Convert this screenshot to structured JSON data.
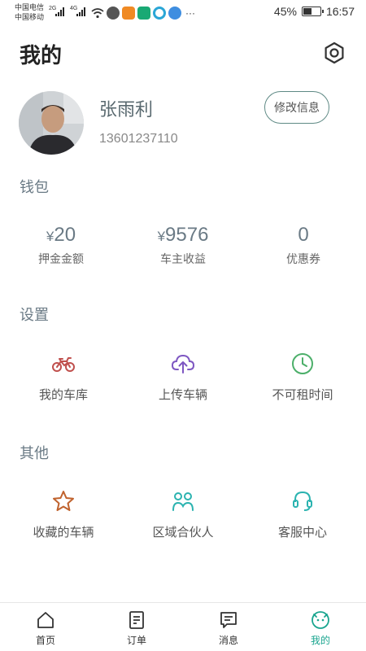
{
  "status_bar": {
    "carrier1": "中国电信",
    "carrier2": "中国移动",
    "net1": "2G",
    "net2": "4G",
    "more": "···",
    "battery": "45%",
    "time": "16:57"
  },
  "header": {
    "title": "我的",
    "settings_icon": "settings-hexagon-icon"
  },
  "profile": {
    "name": "张雨利",
    "phone": "13601237110",
    "edit_label": "修改信息"
  },
  "wallet": {
    "title": "钱包",
    "items": [
      {
        "currency": "¥",
        "value": "20",
        "label": "押金金额"
      },
      {
        "currency": "¥",
        "value": "9576",
        "label": "车主收益"
      },
      {
        "currency": "",
        "value": "0",
        "label": "优惠券"
      }
    ]
  },
  "settings": {
    "title": "设置",
    "items": [
      {
        "icon": "motorcycle-icon",
        "label": "我的车库",
        "color": "#c0504d"
      },
      {
        "icon": "cloud-upload-icon",
        "label": "上传车辆",
        "color": "#7e57c2"
      },
      {
        "icon": "clock-icon",
        "label": "不可租时间",
        "color": "#4caf6a"
      }
    ]
  },
  "other": {
    "title": "其他",
    "items": [
      {
        "icon": "star-icon",
        "label": "收藏的车辆",
        "color": "#c0622d"
      },
      {
        "icon": "partners-icon",
        "label": "区域合伙人",
        "color": "#2bb3b0"
      },
      {
        "icon": "headset-icon",
        "label": "客服中心",
        "color": "#2bb3b0"
      }
    ]
  },
  "bottom_nav": {
    "items": [
      {
        "icon": "home-icon",
        "label": "首页"
      },
      {
        "icon": "order-icon",
        "label": "订单"
      },
      {
        "icon": "message-icon",
        "label": "消息"
      },
      {
        "icon": "profile-face-icon",
        "label": "我的",
        "active": true
      }
    ],
    "active_color": "#1aa58f"
  }
}
